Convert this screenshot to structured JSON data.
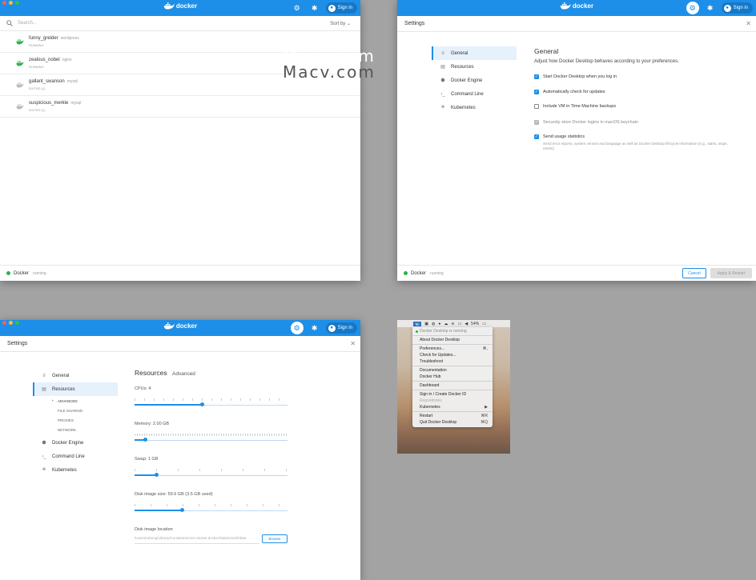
{
  "watermark": {
    "text": "Macv.com"
  },
  "dashboard": {
    "brand": "docker",
    "sign_in": "Sign in",
    "search_placeholder": "Search...",
    "sort_by": "Sort by",
    "containers": [
      {
        "name": "funny_greider",
        "image": "wordpress",
        "status": "RUNNING",
        "color": "#2bb24c"
      },
      {
        "name": "zealous_nobel",
        "image": "nginx",
        "status": "RUNNING",
        "color": "#2bb24c"
      },
      {
        "name": "gallant_swanson",
        "image": "mysql",
        "status": "EXITED (1)",
        "color": "#bbbbbb"
      },
      {
        "name": "suspicious_merkle",
        "image": "mysql",
        "status": "EXITED (1)",
        "color": "#bbbbbb"
      }
    ],
    "status_name": "Docker",
    "status_text": "running"
  },
  "general_settings": {
    "brand": "docker",
    "sign_in": "Sign in",
    "header": "Settings",
    "nav": [
      "General",
      "Resources",
      "Docker Engine",
      "Command Line",
      "Kubernetes"
    ],
    "title": "General",
    "subtitle": "Adjust how Docker Desktop behaves according to your preferences.",
    "options": [
      {
        "label": "Start Docker Desktop when you log in",
        "state": "on"
      },
      {
        "label": "Automatically check for updates",
        "state": "on"
      },
      {
        "label": "Include VM in Time Machine backups",
        "state": "off"
      },
      {
        "label": "Securely store Docker logins in macOS keychain",
        "state": "disabled"
      },
      {
        "label": "Send usage statistics",
        "state": "on",
        "description": "Send error reports, system version and language as well as Docker Desktop lifecycle information (e.g., starts, stops, resets)."
      }
    ],
    "cancel": "Cancel",
    "apply": "Apply & Restart",
    "status_name": "Docker",
    "status_text": "running"
  },
  "resources_settings": {
    "brand": "docker",
    "sign_in": "Sign in",
    "header": "Settings",
    "nav": [
      "General",
      "Resources",
      "Docker Engine",
      "Command Line",
      "Kubernetes"
    ],
    "sub_nav": [
      "ADVANCED",
      "FILE SHARING",
      "PROXIES",
      "NETWORK"
    ],
    "title": "Resources",
    "title_sub": "Advanced",
    "cpus_label": "CPUs:",
    "cpus_value": "4",
    "memory_label": "Memory:",
    "memory_value": "2.00 GB",
    "swap_label": "Swap:",
    "swap_value": "1 GB",
    "disk_label": "Disk image size:",
    "disk_value": "59.6 GB (3.5 GB used)",
    "location_label": "Disk image location",
    "location_value": "/Users/rubeng/Library/Containers/com.docker.docker/Data/vms/0/data",
    "browse": "Browse",
    "slider_levels": {
      "cpus": 0.44,
      "memory": 0.07,
      "swap": 0.14,
      "disk": 0.31
    }
  },
  "menu": {
    "battery": "54%",
    "status": "Docker Desktop is running",
    "items": [
      {
        "label": "About Docker Desktop",
        "shortcut": "",
        "dim": false,
        "sep_before": true
      },
      {
        "label": "Preferences...",
        "shortcut": "⌘,",
        "dim": false,
        "sep_before": true
      },
      {
        "label": "Check for Updates...",
        "shortcut": "",
        "dim": false,
        "sep_before": false
      },
      {
        "label": "Troubleshoot",
        "shortcut": "",
        "dim": false,
        "sep_before": false
      },
      {
        "label": "Documentation",
        "shortcut": "",
        "dim": false,
        "sep_before": true
      },
      {
        "label": "Docker Hub",
        "shortcut": "",
        "dim": false,
        "sep_before": false
      },
      {
        "label": "Dashboard",
        "shortcut": "",
        "dim": false,
        "sep_before": true
      },
      {
        "label": "Sign in / Create Docker ID",
        "shortcut": "",
        "dim": false,
        "sep_before": true
      },
      {
        "label": "Repositories",
        "shortcut": "",
        "dim": true,
        "sep_before": false
      },
      {
        "label": "Kubernetes",
        "shortcut": "▶",
        "dim": false,
        "sep_before": false
      },
      {
        "label": "Restart",
        "shortcut": "⌘R",
        "dim": false,
        "sep_before": true
      },
      {
        "label": "Quit Docker Desktop",
        "shortcut": "⌘Q",
        "dim": false,
        "sep_before": false
      }
    ]
  }
}
